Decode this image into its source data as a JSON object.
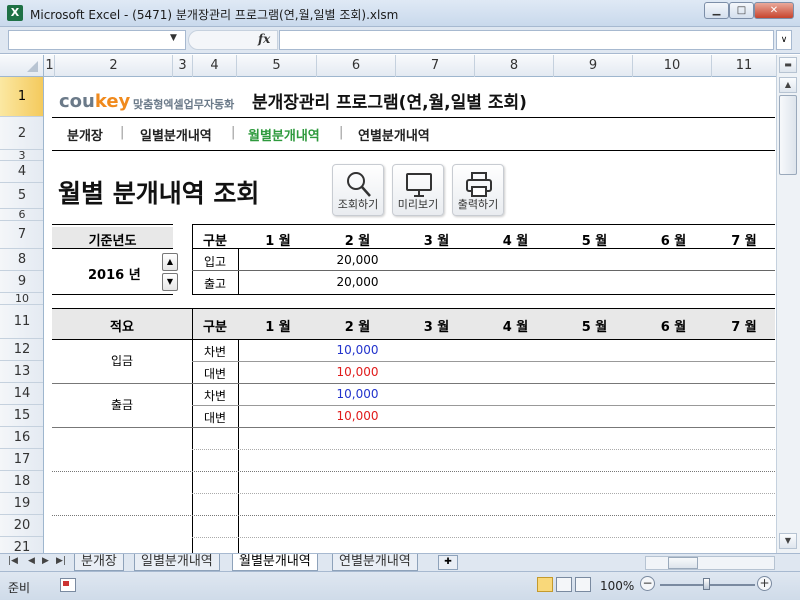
{
  "window": {
    "title": "Microsoft Excel - (5471) 분개장관리 프로그램(연,월,일별 조회).xlsm",
    "app_icon": "X",
    "min_label": "▁",
    "max_label": "□",
    "close_label": "✕"
  },
  "formula_bar": {
    "name_box": "",
    "fx": "fx",
    "formula": ""
  },
  "columns": [
    "1",
    "2",
    "3",
    "4",
    "5",
    "6",
    "7",
    "8",
    "9",
    "10",
    "11"
  ],
  "rows": [
    "1",
    "2",
    "3",
    "4",
    "5",
    "6",
    "7",
    "8",
    "9",
    "10",
    "11",
    "12",
    "13",
    "14",
    "15",
    "16",
    "17",
    "18",
    "19",
    "20",
    "21"
  ],
  "brand": {
    "cou": "cou",
    "key": "key",
    "tagline": "맞춤형엑셀업무자동화"
  },
  "program_title": "분개장관리 프로그램(연,월,일별 조회)",
  "nav": [
    "분개장",
    "일별분개내역",
    "월별분개내역",
    "연별분개내역"
  ],
  "nav_sep": "|",
  "page_title": "월별 분개내역 조회",
  "buttons": {
    "search": "조회하기",
    "preview": "미리보기",
    "print": "출력하기"
  },
  "year_box": {
    "label": "기준년도",
    "value": "2016 년",
    "up": "▲",
    "down": "▼"
  },
  "summary": {
    "header": [
      "구분",
      "1 월",
      "2 월",
      "3 월",
      "4 월",
      "5 월",
      "6 월",
      "7 월"
    ],
    "rows": [
      {
        "label": "입고",
        "values": [
          "",
          "20,000",
          "",
          "",
          "",
          "",
          ""
        ]
      },
      {
        "label": "출고",
        "values": [
          "",
          "20,000",
          "",
          "",
          "",
          "",
          ""
        ]
      }
    ]
  },
  "detail": {
    "header": [
      "적요",
      "구분",
      "1 월",
      "2 월",
      "3 월",
      "4 월",
      "5 월",
      "6 월",
      "7 월"
    ],
    "groups": [
      {
        "label": "입금",
        "rows": [
          {
            "type": "차변",
            "feb": "10,000"
          },
          {
            "type": "대변",
            "feb": "10,000"
          }
        ]
      },
      {
        "label": "출금",
        "rows": [
          {
            "type": "차변",
            "feb": "10,000"
          },
          {
            "type": "대변",
            "feb": "10,000"
          }
        ]
      }
    ]
  },
  "sheet_tabs": [
    "분개장",
    "일별분개내역",
    "월별분개내역",
    "연별분개내역"
  ],
  "active_tab": "월별분개내역",
  "status": {
    "ready": "준비",
    "zoom": "100%",
    "zoom_minus": "−",
    "zoom_plus": "+"
  },
  "colors": {
    "accent_green": "#2e9a3d",
    "debit_blue": "#2233cc",
    "credit_red": "#e01b1b",
    "brand_orange": "#f08a1d"
  }
}
